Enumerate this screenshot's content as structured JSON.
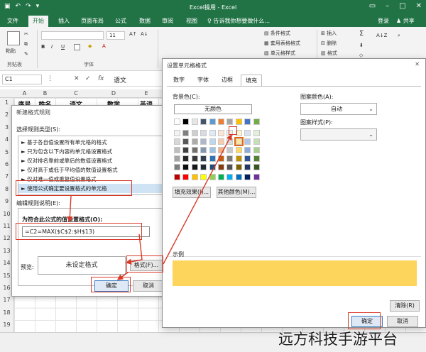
{
  "window": {
    "title": "Excel操用 - Excel",
    "login": "登录",
    "share": "共享"
  },
  "tabs": [
    "文件",
    "开始",
    "插入",
    "页面布局",
    "公式",
    "数据",
    "审阅",
    "视图"
  ],
  "active_tab": "开始",
  "tell_me": "告诉我你想要做什么...",
  "ribbon": {
    "paste": "粘贴",
    "clipboard": "剪贴板",
    "font_size": "11",
    "font_group": "字体",
    "cond_format": "条件格式",
    "table_format": "套用表格格式",
    "cell_style": "单元格样式",
    "insert": "插入",
    "delete": "删除",
    "format": "格式"
  },
  "formula_bar": {
    "name_box": "C1",
    "value": "语文"
  },
  "sheet": {
    "columns": [
      "A",
      "B",
      "C",
      "D",
      "E"
    ],
    "headers": [
      "序号",
      "姓名",
      "语文",
      "数学",
      "英语"
    ],
    "rows": [
      "1",
      "2",
      "3",
      "4",
      "5",
      "6",
      "7",
      "8",
      "9",
      "10",
      "11",
      "12",
      "13",
      "14",
      "15",
      "16",
      "17",
      "18",
      "19"
    ]
  },
  "rule_dialog": {
    "title": "新建格式规则",
    "select_type_label": "选择规则类型(S):",
    "rules": [
      "► 基于各自值设置所有单元格的格式",
      "► 只为包含以下内容的单元格设置格式",
      "► 仅对排名靠前或靠后的数值设置格式",
      "► 仅对高于或低于平均值的数值设置格式",
      "► 仅对唯一值或重复值设置格式",
      "► 使用公式确定要设置格式的单元格"
    ],
    "edit_label": "编辑规则说明(E):",
    "formula_label": "为符合此公式的值设置格式(O):",
    "formula": "=C2=MAX($C$2:$H$13)",
    "preview_label": "预览:",
    "preview_text": "未设定格式",
    "format_button": "格式(F)...",
    "ok": "确定",
    "cancel": "取消"
  },
  "format_dialog": {
    "title": "设置单元格格式",
    "tabs": [
      "数字",
      "字体",
      "边框",
      "填充"
    ],
    "active_tab": "填充",
    "bg_color_label": "背景色(C):",
    "no_color": "无颜色",
    "fill_effects": "填充效果(I)...",
    "more_colors": "其他颜色(M)...",
    "pattern_color_label": "图案颜色(A):",
    "pattern_color_value": "自动",
    "pattern_style_label": "图案样式(P):",
    "sample_label": "示例",
    "sample_color": "#fdd55c",
    "clear": "清除(R)",
    "ok": "确定",
    "cancel": "取消"
  },
  "highlight_color": "#d83a2a",
  "watermark": "远方科技手游平台"
}
